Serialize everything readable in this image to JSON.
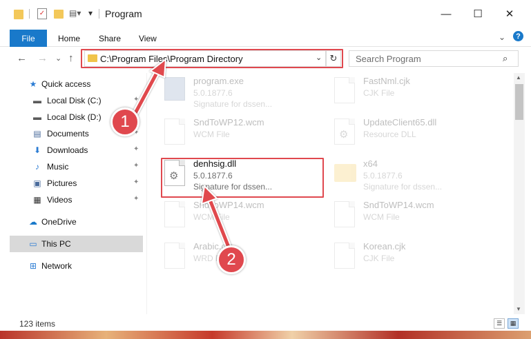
{
  "window": {
    "title": "Program",
    "minimize_glyph": "—",
    "maximize_glyph": "☐",
    "close_glyph": "✕"
  },
  "ribbon": {
    "tabs": [
      "File",
      "Home",
      "Share",
      "View"
    ],
    "expand_glyph": "⌄",
    "help_glyph": "?"
  },
  "nav": {
    "back_glyph": "←",
    "forward_glyph": "→",
    "recent_glyph": "⌄",
    "up_glyph": "↑",
    "address": "C:\\Program Files\\Program Directory",
    "address_dropdown_glyph": "⌄",
    "refresh_glyph": "↻",
    "search_placeholder": "Search Program",
    "search_glyph": "⌕"
  },
  "sidebar": {
    "items": [
      {
        "label": "Quick access",
        "icon": "star-icon",
        "glyph": "★",
        "color": "#2b7cd3"
      },
      {
        "label": "Local Disk (C:)",
        "icon": "drive-icon",
        "glyph": "▬",
        "color": "#5a5a5a"
      },
      {
        "label": "Local Disk (D:)",
        "icon": "drive-icon",
        "glyph": "▬",
        "color": "#5a5a5a"
      },
      {
        "label": "Documents",
        "icon": "documents-icon",
        "glyph": "▤",
        "color": "#4a6b9b"
      },
      {
        "label": "Downloads",
        "icon": "downloads-icon",
        "glyph": "⬇",
        "color": "#2b7cd3"
      },
      {
        "label": "Music",
        "icon": "music-icon",
        "glyph": "♪",
        "color": "#2b7cd3"
      },
      {
        "label": "Pictures",
        "icon": "pictures-icon",
        "glyph": "▣",
        "color": "#4a6b9b"
      },
      {
        "label": "Videos",
        "icon": "videos-icon",
        "glyph": "▦",
        "color": "#333333"
      },
      {
        "label": "OneDrive",
        "icon": "cloud-icon",
        "glyph": "☁",
        "color": "#1979ca"
      },
      {
        "label": "This PC",
        "icon": "computer-icon",
        "glyph": "▭",
        "color": "#2b7cd3"
      },
      {
        "label": "Network",
        "icon": "network-icon",
        "glyph": "⊞",
        "color": "#2b7cd3"
      }
    ],
    "pin_glyph": "📌"
  },
  "files": [
    {
      "name": "program.exe",
      "line2": "5.0.1877.6",
      "line3": "Signature for dssen...",
      "icon": "exe-icon"
    },
    {
      "name": "FastNml.cjk",
      "line2": "CJK File",
      "line3": "",
      "icon": "file-icon"
    },
    {
      "name": "SndToWP12.wcm",
      "line2": "WCM File",
      "line3": "",
      "icon": "file-icon"
    },
    {
      "name": "UpdateClient65.dll",
      "line2": "Resource DLL",
      "line3": "",
      "icon": "dll-icon"
    },
    {
      "name": "denhsig.dll",
      "line2": "5.0.1877.6",
      "line3": "Signature for dssen...",
      "icon": "dll-icon"
    },
    {
      "name": "x64",
      "line2": "5.0.1877.6",
      "line3": "Signature for dssen...",
      "icon": "folder-icon"
    },
    {
      "name": "SndToWP14.wcm",
      "line2": "WCM File",
      "line3": "",
      "icon": "file-icon"
    },
    {
      "name": "SndToWP14.wcm",
      "line2": "WCM File",
      "line3": "",
      "icon": "file-icon"
    },
    {
      "name": "Arabic.cjk",
      "line2": "WRD File",
      "line3": "",
      "icon": "file-icon"
    },
    {
      "name": "Korean.cjk",
      "line2": "CJK File",
      "line3": "",
      "icon": "file-icon"
    }
  ],
  "status": {
    "items_count": "123 items"
  },
  "callouts": {
    "one": "1",
    "two": "2"
  },
  "colors": {
    "accent": "#1979ca",
    "highlight": "#e0484e"
  }
}
